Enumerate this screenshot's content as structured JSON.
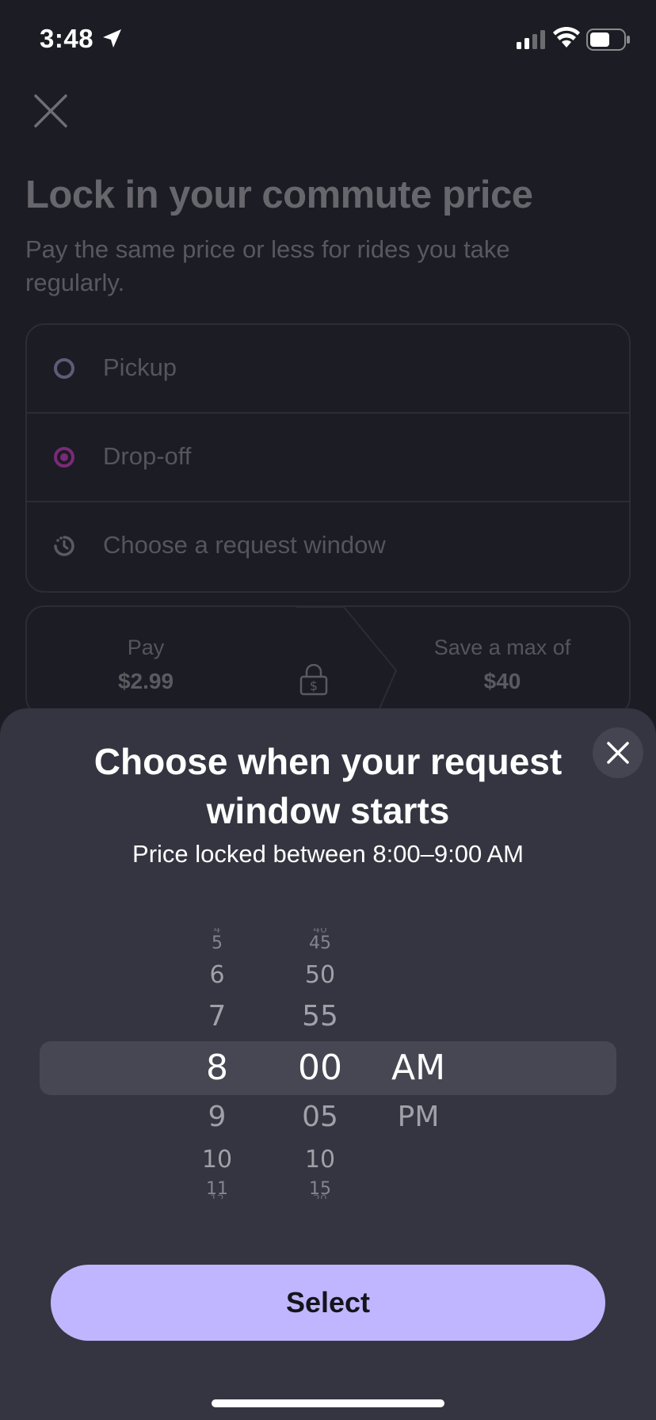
{
  "status_bar": {
    "time": "3:48"
  },
  "background": {
    "title": "Lock in your commute price",
    "subtitle": "Pay the same price or less for rides you take regularly.",
    "route": {
      "pickup_label": "Pickup",
      "dropoff_label": "Drop-off",
      "window_label": "Choose a request window"
    },
    "price": {
      "pay_label": "Pay",
      "pay_value": "$2.99",
      "save_label": "Save a max of",
      "save_value": "$40"
    }
  },
  "sheet": {
    "title": "Choose when your request window starts",
    "subtitle": "Price locked between 8:00–9:00 AM",
    "picker": {
      "hours": [
        "4",
        "5",
        "6",
        "7",
        "8",
        "9",
        "10",
        "11",
        "12"
      ],
      "minutes": [
        "40",
        "45",
        "50",
        "55",
        "00",
        "05",
        "10",
        "15",
        "20"
      ],
      "periods": [
        "AM",
        "PM"
      ],
      "selected_hour": "8",
      "selected_minute": "00",
      "selected_period": "AM"
    },
    "select_label": "Select"
  },
  "colors": {
    "accent": "#c0b6ff",
    "sheet_bg": "#353541",
    "dropoff_dot": "#8b2a88"
  },
  "icons": [
    "location-arrow-icon",
    "signal-icon",
    "wifi-icon",
    "battery-icon",
    "close-icon",
    "pickup-circle-icon",
    "dropoff-dot-icon",
    "clock-icon",
    "lock-dollar-icon",
    "sheet-close-icon"
  ]
}
